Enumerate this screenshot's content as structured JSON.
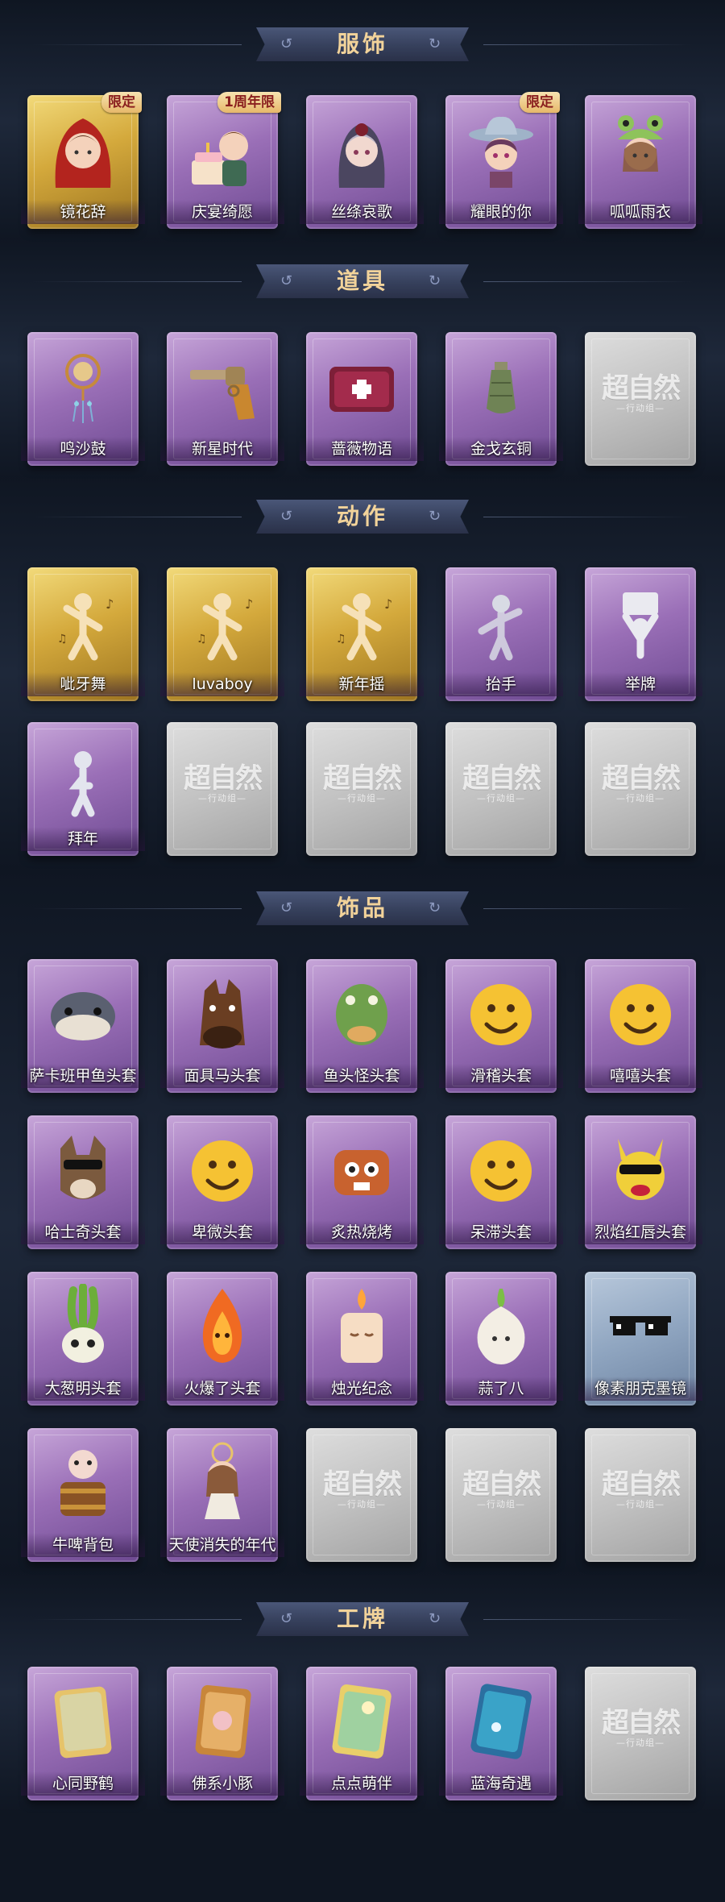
{
  "placeholder": {
    "logo": "超自然",
    "sub": "—行动组—"
  },
  "colors": {
    "accent": "#f2d39a",
    "background": "#0f1622",
    "tag_text": "#8a1f1f"
  },
  "sections": {
    "costume": {
      "title": "服饰",
      "items": [
        {
          "name": "镜花辞",
          "tag": "限定",
          "frame": "gold",
          "icon": "red-hood-girl-icon"
        },
        {
          "name": "庆宴绮愿",
          "tag": "1周年限",
          "frame": "purple",
          "icon": "cake-girl-icon"
        },
        {
          "name": "丝绦哀歌",
          "tag": "",
          "frame": "purple",
          "icon": "gothic-girl-icon"
        },
        {
          "name": "耀眼的你",
          "tag": "限定",
          "frame": "purple",
          "icon": "cowboy-hat-girl-icon"
        },
        {
          "name": "呱呱雨衣",
          "tag": "",
          "frame": "purple",
          "icon": "frog-hat-girl-icon"
        }
      ]
    },
    "props": {
      "title": "道具",
      "items": [
        {
          "name": "鸣沙鼓",
          "frame": "purple",
          "icon": "drum-icon"
        },
        {
          "name": "新星时代",
          "frame": "purple",
          "icon": "revolver-icon"
        },
        {
          "name": "蔷薇物语",
          "frame": "purple",
          "icon": "medkit-icon"
        },
        {
          "name": "金戈玄铜",
          "frame": "purple",
          "icon": "grenade-icon"
        },
        {
          "name": "",
          "frame": "gray",
          "icon": "placeholder-logo"
        }
      ]
    },
    "actions": {
      "title": "动作",
      "items": [
        {
          "name": "呲牙舞",
          "frame": "gold",
          "icon": "dance-pose-icon"
        },
        {
          "name": "luvaboy",
          "frame": "gold",
          "icon": "heart-pose-icon"
        },
        {
          "name": "新年摇",
          "frame": "gold",
          "icon": "shake-pose-icon"
        },
        {
          "name": "抬手",
          "frame": "purple",
          "icon": "raise-hand-icon"
        },
        {
          "name": "举牌",
          "frame": "purple",
          "icon": "sign-pose-icon"
        },
        {
          "name": "拜年",
          "frame": "purple",
          "icon": "bow-pose-icon"
        },
        {
          "name": "",
          "frame": "gray",
          "icon": "placeholder-logo"
        },
        {
          "name": "",
          "frame": "gray",
          "icon": "placeholder-logo"
        },
        {
          "name": "",
          "frame": "gray",
          "icon": "placeholder-logo"
        },
        {
          "name": "",
          "frame": "gray",
          "icon": "placeholder-logo"
        }
      ]
    },
    "accessories": {
      "title": "饰品",
      "items": [
        {
          "name": "萨卡班甲鱼头套",
          "frame": "purple",
          "icon": "fish-head-icon"
        },
        {
          "name": "面具马头套",
          "frame": "purple",
          "icon": "horse-head-icon"
        },
        {
          "name": "鱼头怪头套",
          "frame": "purple",
          "icon": "fish-monster-icon"
        },
        {
          "name": "滑稽头套",
          "frame": "purple",
          "icon": "smirk-emoji-icon"
        },
        {
          "name": "嘻嘻头套",
          "frame": "purple",
          "icon": "grin-emoji-icon"
        },
        {
          "name": "哈士奇头套",
          "frame": "purple",
          "icon": "husky-head-icon"
        },
        {
          "name": "卑微头套",
          "frame": "purple",
          "icon": "humble-emoji-icon"
        },
        {
          "name": "炙热烧烤",
          "frame": "purple",
          "icon": "bbq-icon"
        },
        {
          "name": "呆滞头套",
          "frame": "purple",
          "icon": "dazed-emoji-icon"
        },
        {
          "name": "烈焰红唇头套",
          "frame": "purple",
          "icon": "yellow-mouse-icon"
        },
        {
          "name": "大葱明头套",
          "frame": "purple",
          "icon": "scallion-icon"
        },
        {
          "name": "火爆了头套",
          "frame": "purple",
          "icon": "fire-icon"
        },
        {
          "name": "烛光纪念",
          "frame": "purple",
          "icon": "candle-icon"
        },
        {
          "name": "蒜了八",
          "frame": "purple",
          "icon": "garlic-icon"
        },
        {
          "name": "像素朋克墨镜",
          "frame": "blue",
          "icon": "pixel-sunglasses-icon"
        },
        {
          "name": "牛啤背包",
          "frame": "purple",
          "icon": "cow-backpack-icon"
        },
        {
          "name": "天使消失的年代",
          "frame": "purple",
          "icon": "angel-doll-icon"
        },
        {
          "name": "",
          "frame": "gray",
          "icon": "placeholder-logo"
        },
        {
          "name": "",
          "frame": "gray",
          "icon": "placeholder-logo"
        },
        {
          "name": "",
          "frame": "gray",
          "icon": "placeholder-logo"
        }
      ]
    },
    "badges": {
      "title": "工牌",
      "items": [
        {
          "name": "心同野鹤",
          "frame": "purple",
          "icon": "gold-card-icon"
        },
        {
          "name": "佛系小豚",
          "frame": "purple",
          "icon": "pig-card-icon"
        },
        {
          "name": "点点萌伴",
          "frame": "purple",
          "icon": "landscape-card-icon"
        },
        {
          "name": "蓝海奇遇",
          "frame": "purple",
          "icon": "ocean-card-icon"
        },
        {
          "name": "",
          "frame": "gray",
          "icon": "placeholder-logo"
        }
      ]
    }
  }
}
